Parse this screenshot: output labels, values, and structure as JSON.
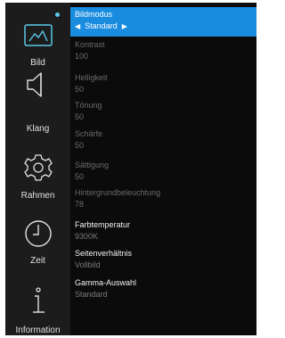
{
  "sidebar": {
    "items": [
      {
        "label": "Bild",
        "icon": "picture-icon"
      },
      {
        "label": "Klang",
        "icon": "speaker-icon"
      },
      {
        "label": "Rahmen",
        "icon": "gear-icon"
      },
      {
        "label": "Zeit",
        "icon": "clock-icon"
      },
      {
        "label": "Information",
        "icon": "info-icon"
      }
    ]
  },
  "menu": {
    "selected": {
      "title": "Bildmodus",
      "value": "Standard",
      "left_arrow": "◀",
      "right_arrow": "▶"
    },
    "items": [
      {
        "title": "Kontrast",
        "value": "100"
      },
      {
        "title": "Helligkeit",
        "value": "50"
      },
      {
        "title": "Tönung",
        "value": "50"
      },
      {
        "title": "Schärfe",
        "value": "50"
      },
      {
        "title": "Sättigung",
        "value": "50"
      },
      {
        "title": "Hintergrundbeleuchtung",
        "value": "78"
      },
      {
        "title": "Farbtemperatur",
        "value": "9300K"
      },
      {
        "title": "Seitenverhältnis",
        "value": "Vollbild"
      },
      {
        "title": "Gamma-Auswahl",
        "value": "Standard"
      }
    ]
  },
  "colors": {
    "accent": "#1a8ce0",
    "status_dot": "#5bc8e8"
  }
}
